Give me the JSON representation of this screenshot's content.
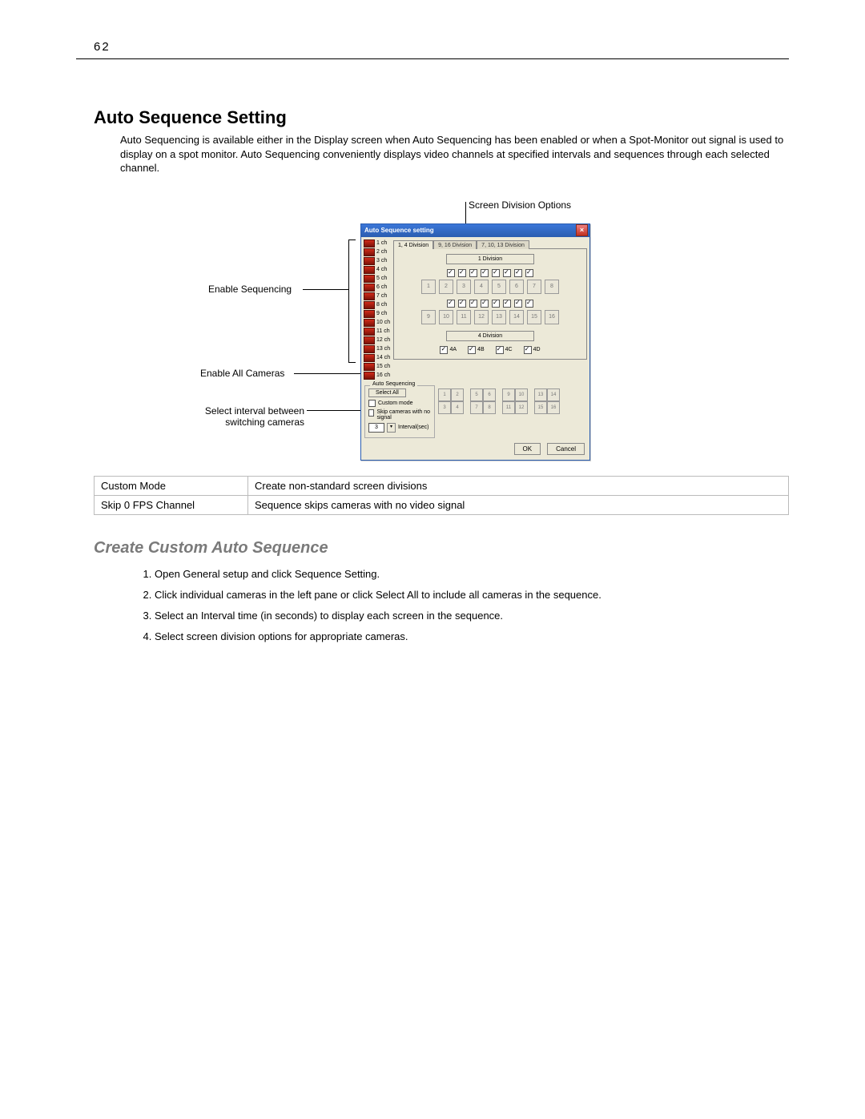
{
  "page_number": "62",
  "section_title": "Auto Sequence Setting",
  "intro_text": "Auto Sequencing is available either in the Display screen when Auto Sequencing has been enabled or when a Spot-Monitor out signal is used to display on a spot monitor. Auto Sequencing conveniently displays video channels at specified intervals and sequences through each selected channel.",
  "callouts": {
    "top": "Screen Division Options",
    "enable_seq": "Enable Sequencing",
    "enable_all": "Enable All Cameras",
    "interval": "Select interval between switching cameras"
  },
  "dialog": {
    "title": "Auto Sequence setting",
    "channels": [
      "1 ch",
      "2 ch",
      "3 ch",
      "4 ch",
      "5 ch",
      "6 ch",
      "7 ch",
      "8 ch",
      "9 ch",
      "10 ch",
      "11 ch",
      "12 ch",
      "13 ch",
      "14 ch",
      "15 ch",
      "16 ch"
    ],
    "tab_active": "1, 4 Division",
    "tab_inactive_1": "9, 16 Division",
    "tab_inactive_2": "7, 10, 13 Division",
    "group_1div": "1 Division",
    "row1": [
      "1",
      "2",
      "3",
      "4",
      "5",
      "6",
      "7",
      "8"
    ],
    "row2": [
      "9",
      "10",
      "11",
      "12",
      "13",
      "14",
      "15",
      "16"
    ],
    "group_4div": "4 Division",
    "quads": [
      "4A",
      "4B",
      "4C",
      "4D"
    ],
    "auto_seq_legend": "Auto Sequencing",
    "select_all": "Select All",
    "custom_mode": "Custom mode",
    "skip_cam": "Skip cameras with no signal",
    "interval_value": "3",
    "interval_label": "Interval(sec)",
    "ok": "OK",
    "cancel": "Cancel"
  },
  "options_table": [
    {
      "name": "Custom Mode",
      "desc": "Create non-standard screen divisions"
    },
    {
      "name": "Skip 0 FPS Channel",
      "desc": "Sequence skips cameras with no video signal"
    }
  ],
  "subsection_title": "Create Custom Auto Sequence",
  "steps": [
    "Open General setup and click Sequence Setting.",
    "Click individual cameras in the left pane or click Select All to include all cameras in the sequence.",
    "Select an Interval time (in seconds) to display each screen in the sequence.",
    "Select screen division options for appropriate cameras."
  ]
}
